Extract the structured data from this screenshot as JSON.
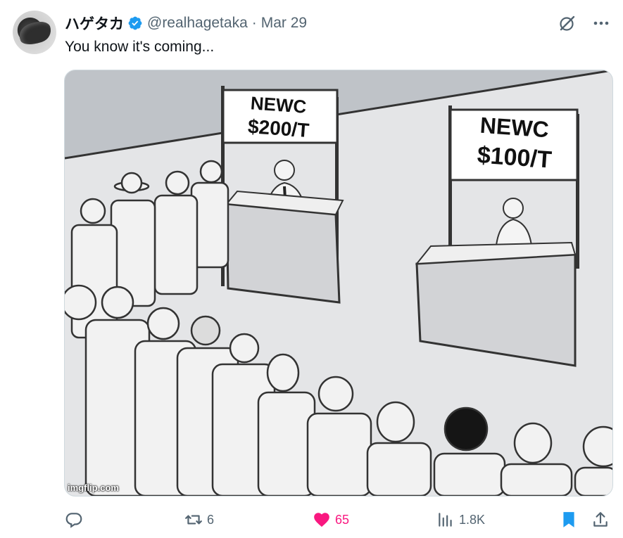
{
  "author": {
    "display_name": "ハゲタカ",
    "handle": "@realhagetaka",
    "separator": "·",
    "date": "Mar 29",
    "verified": true
  },
  "tweet": {
    "text": "You know it's coming..."
  },
  "media": {
    "watermark": "imgflip.com",
    "left_sign": [
      "NEWC",
      "$200/T"
    ],
    "right_sign": [
      "NEWC",
      "$100/T"
    ]
  },
  "actions": {
    "reply_count": "",
    "retweet_count": "6",
    "like_count": "65",
    "views_count": "1.8K"
  },
  "colors": {
    "accent": "#1d9bf0",
    "like": "#f91880",
    "muted": "#536471"
  },
  "icons": [
    "verified-badge-icon",
    "grok-icon",
    "more-icon",
    "reply-icon",
    "retweet-icon",
    "like-icon",
    "views-icon",
    "bookmark-icon",
    "share-icon"
  ]
}
